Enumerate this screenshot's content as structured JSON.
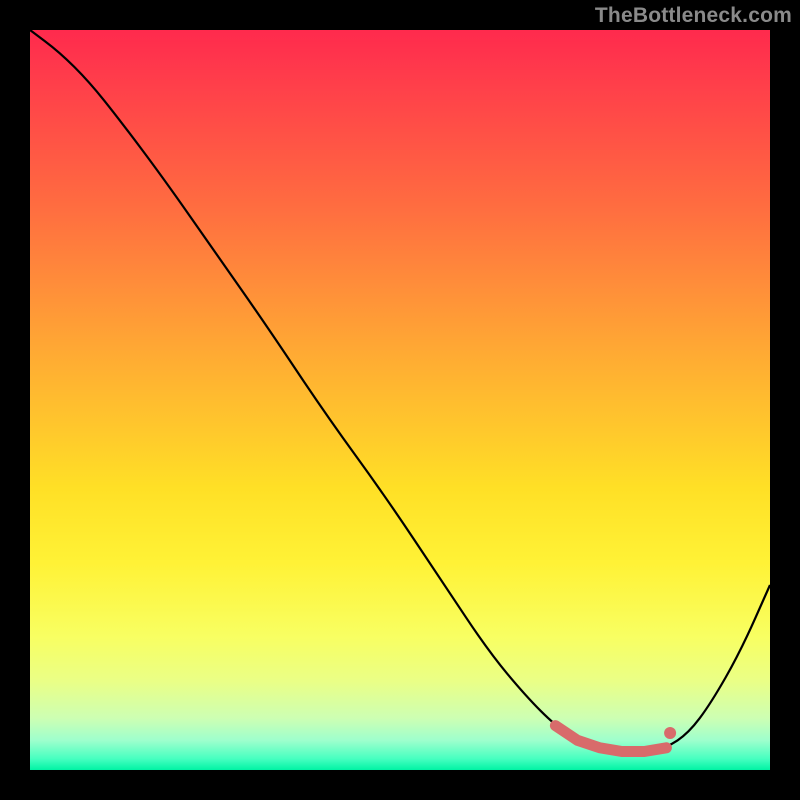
{
  "watermark": "TheBottleneck.com",
  "chart_data": {
    "type": "line",
    "title": "",
    "xlabel": "",
    "ylabel": "",
    "xlim": [
      0,
      100
    ],
    "ylim": [
      0,
      100
    ],
    "series": [
      {
        "name": "curve",
        "x": [
          0,
          4,
          8,
          12,
          18,
          25,
          32,
          40,
          48,
          56,
          62,
          67,
          71,
          74,
          77,
          80,
          83,
          86,
          89,
          92,
          96,
          100
        ],
        "y": [
          100,
          97,
          93,
          88,
          80,
          70,
          60,
          48,
          37,
          25,
          16,
          10,
          6,
          4,
          3,
          2.5,
          2.5,
          3,
          5,
          9,
          16,
          25
        ]
      }
    ],
    "highlight_band": {
      "x_start": 70,
      "x_end": 86,
      "y": 3
    },
    "highlight_dot": {
      "x": 86.5,
      "y": 5
    },
    "background": "rainbow-vertical"
  }
}
